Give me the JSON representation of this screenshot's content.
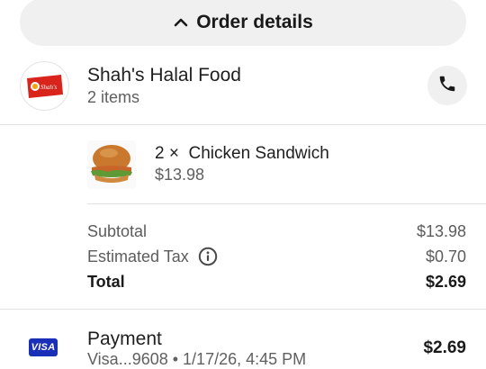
{
  "order_details": {
    "label": "Order details",
    "icon": "chevron-up-icon"
  },
  "restaurant": {
    "name": "Shah's Halal Food",
    "items_count": "2 items",
    "logo_text": "Shah's",
    "call_icon": "phone-icon"
  },
  "item": {
    "title": "2 ×  Chicken Sandwich",
    "price": "$13.98"
  },
  "summary": {
    "subtotal_label": "Subtotal",
    "subtotal_value": "$13.98",
    "tax_label": "Estimated Tax",
    "tax_value": "$0.70",
    "total_label": "Total",
    "total_value": "$2.69"
  },
  "payment": {
    "title": "Payment",
    "card_brand": "VISA",
    "details": "Visa...9608 • 1/17/26, 4:45 PM",
    "amount": "$2.69"
  },
  "colors": {
    "pill_bg": "#f0f0f0",
    "visa_blue": "#1a2fb8",
    "logo_red": "#d9241c"
  }
}
